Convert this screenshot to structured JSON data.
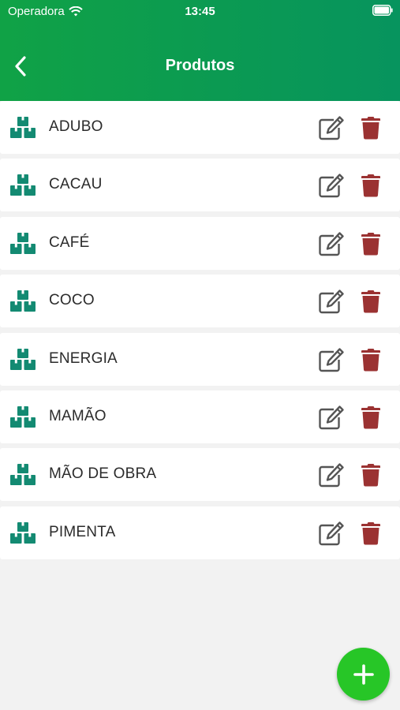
{
  "status_bar": {
    "carrier": "Operadora",
    "time": "13:45"
  },
  "header": {
    "title": "Produtos",
    "back_icon": "chevron-left-icon"
  },
  "products": [
    {
      "label": "ADUBO"
    },
    {
      "label": "CACAU"
    },
    {
      "label": "CAFÉ"
    },
    {
      "label": "COCO"
    },
    {
      "label": "ENERGIA"
    },
    {
      "label": "MAMÃO"
    },
    {
      "label": "MÃO DE OBRA"
    },
    {
      "label": "PIMENTA"
    }
  ],
  "icons": {
    "product": "boxes-icon",
    "edit": "edit-icon",
    "delete": "trash-icon",
    "add": "plus-icon"
  },
  "colors": {
    "header_start": "#10a246",
    "header_end": "#07945e",
    "product_icon": "#138a72",
    "edit_icon": "#555555",
    "delete_icon": "#9b3232",
    "fab": "#27c627"
  }
}
